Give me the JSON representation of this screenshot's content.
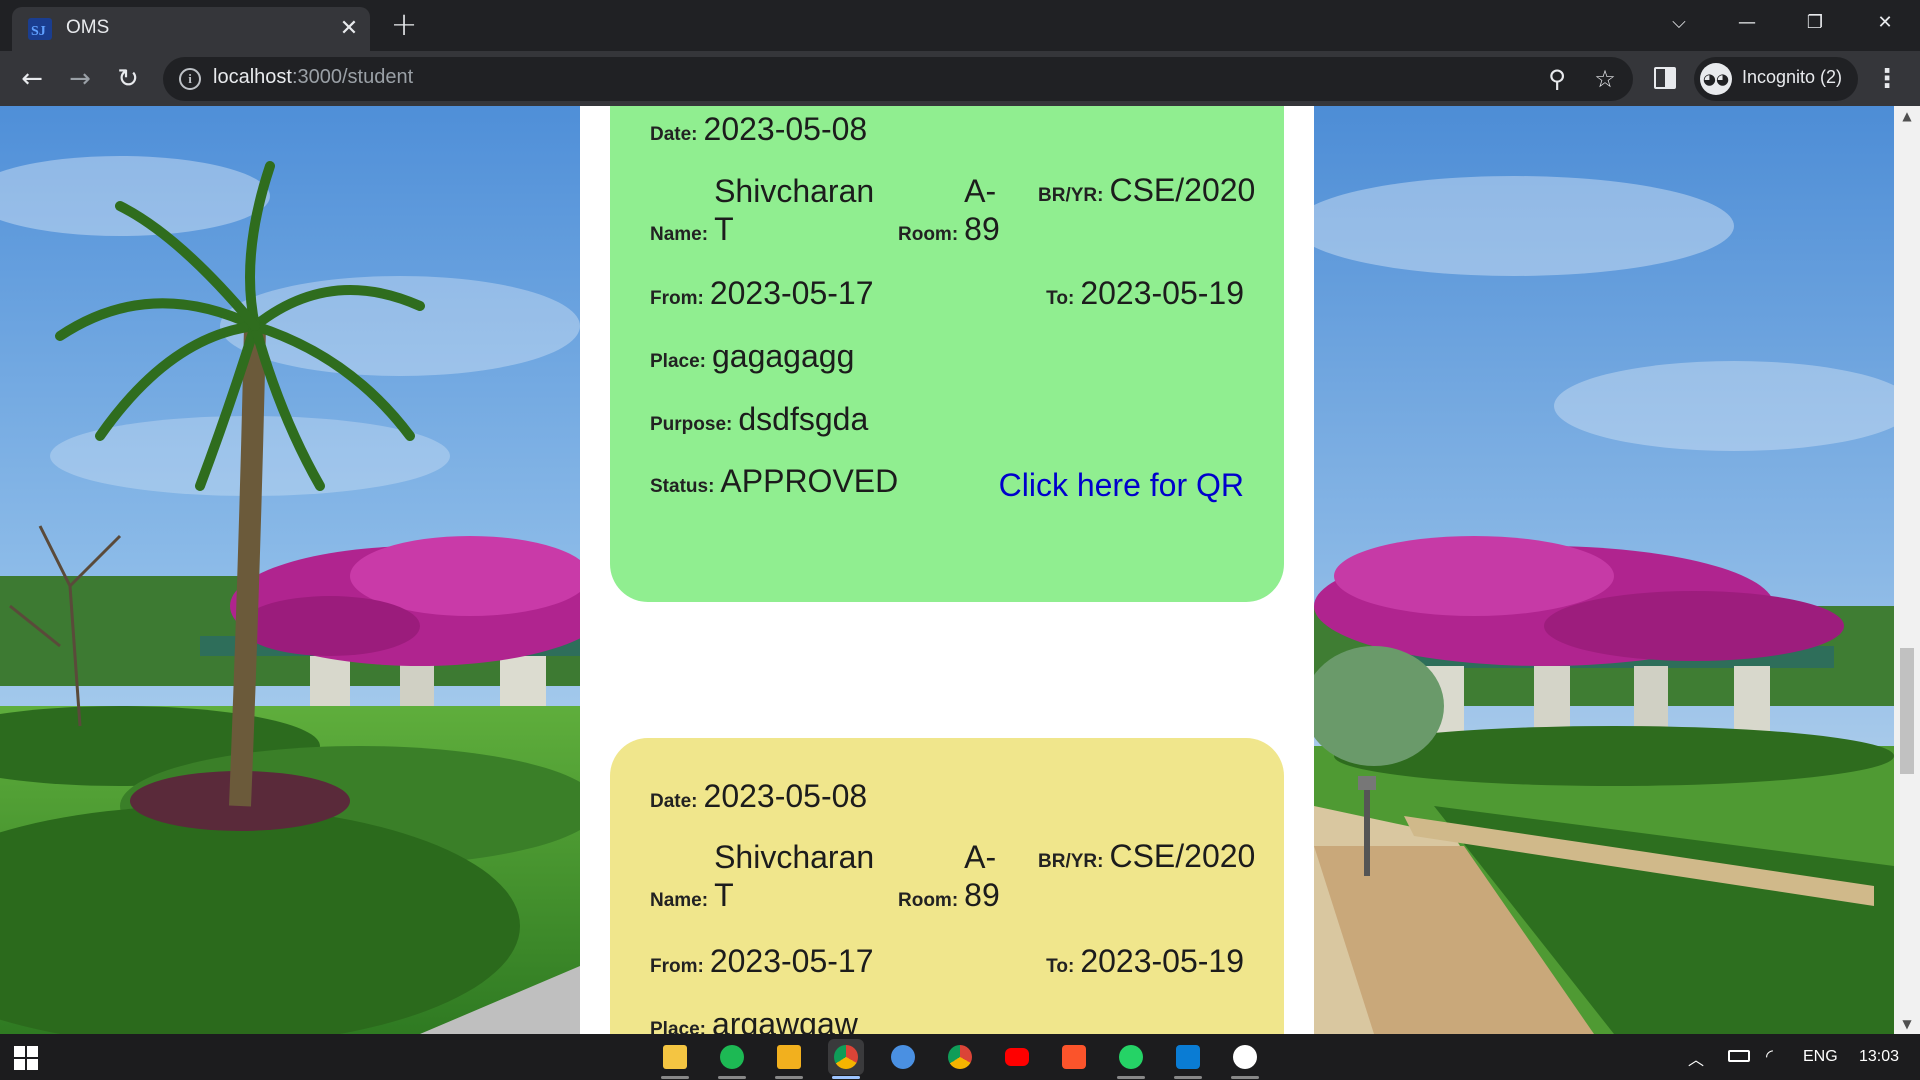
{
  "browser": {
    "tab_title": "OMS",
    "url_host": "localhost",
    "url_path": ":3000/student",
    "profile_label": "Incognito (2)"
  },
  "cards": [
    {
      "color": "#90ee90",
      "date_label": "Date:",
      "date": "2023-05-08",
      "name_label": "Name:",
      "name_line1": "Shivcharan",
      "name_line2": "T",
      "room_label": "Room:",
      "room_line1": "A-",
      "room_line2": "89",
      "bryr_label": "BR/YR:",
      "bryr": "CSE/2020",
      "from_label": "From:",
      "from": "2023-05-17",
      "to_label": "To:",
      "to": "2023-05-19",
      "place_label": "Place:",
      "place": "gagagagg",
      "purpose_label": "Purpose:",
      "purpose": "dsdfsgda",
      "status_label": "Status:",
      "status": "APPROVED",
      "qr_link": "Click here for QR"
    },
    {
      "color": "#f0e68c",
      "date_label": "Date:",
      "date": "2023-05-08",
      "name_label": "Name:",
      "name_line1": "Shivcharan",
      "name_line2": "T",
      "room_label": "Room:",
      "room_line1": "A-",
      "room_line2": "89",
      "bryr_label": "BR/YR:",
      "bryr": "CSE/2020",
      "from_label": "From:",
      "from": "2023-05-17",
      "to_label": "To:",
      "to": "2023-05-19",
      "place_label": "Place:",
      "place": "argawgaw"
    }
  ],
  "taskbar": {
    "language": "ENG",
    "time": "13:03"
  }
}
